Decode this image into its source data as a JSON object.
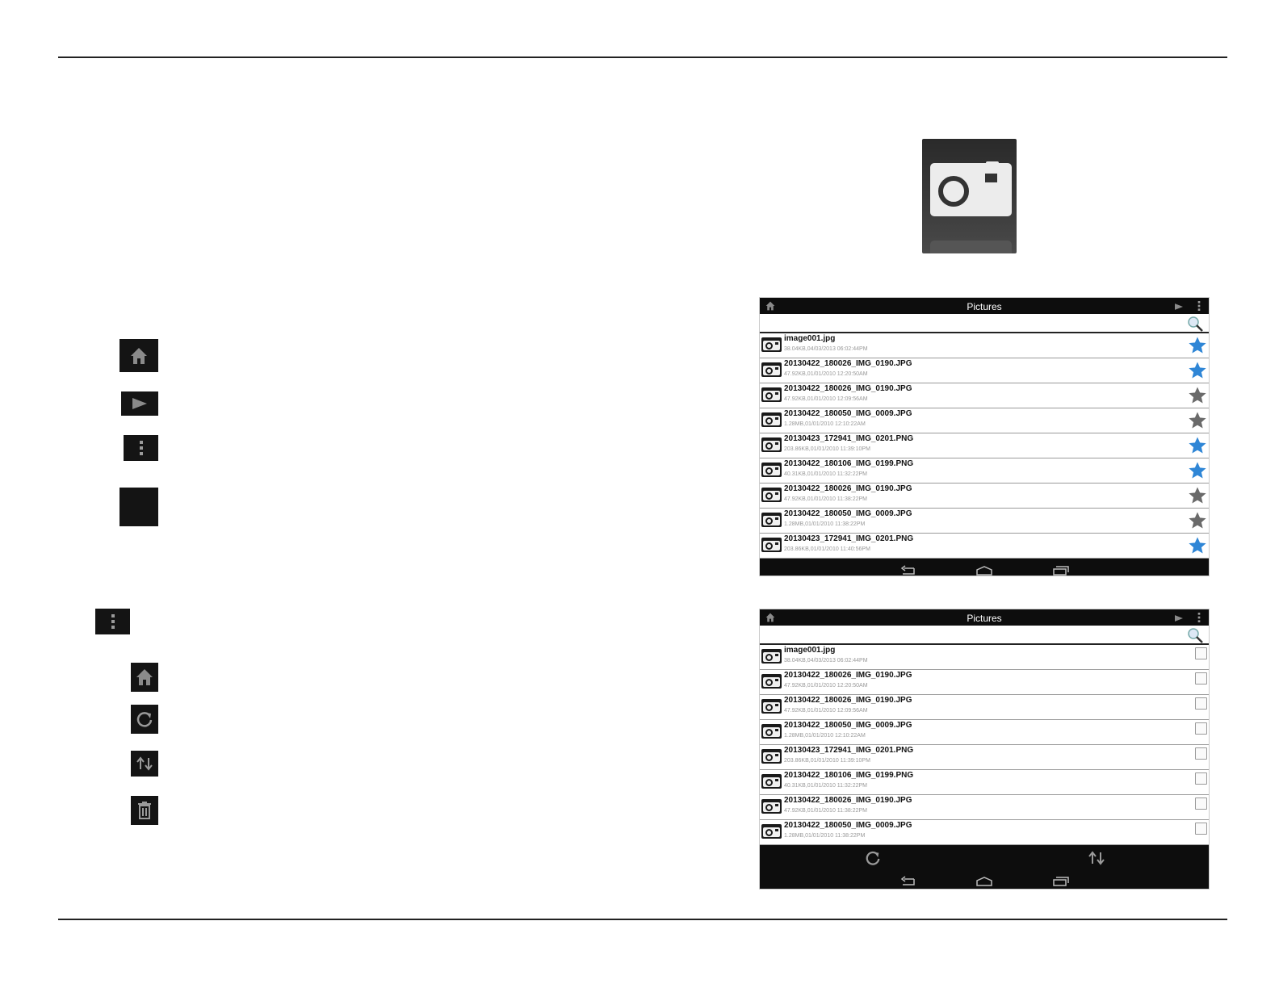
{
  "doc": {
    "icons_left": [
      {
        "name": "home-icon"
      },
      {
        "name": "play-icon"
      },
      {
        "name": "more-options-icon"
      },
      {
        "name": "blank-square-icon"
      }
    ],
    "menu_icon": "more-options-icon",
    "menu_icons": [
      {
        "name": "home-icon"
      },
      {
        "name": "refresh-icon"
      },
      {
        "name": "sort-icon"
      },
      {
        "name": "trash-icon"
      }
    ],
    "big_icon": "camera-icon"
  },
  "screens": [
    {
      "title": "Pictures",
      "rows": [
        {
          "name": "image001.jpg",
          "meta": "38.04KB,04/03/2013 06:02:44PM",
          "starred": true
        },
        {
          "name": "20130422_180026_IMG_0190.JPG",
          "meta": "47.92KB,01/01/2010 12:20:50AM",
          "starred": true
        },
        {
          "name": "20130422_180026_IMG_0190.JPG",
          "meta": "47.92KB,01/01/2010 12:09:56AM",
          "starred": false
        },
        {
          "name": "20130422_180050_IMG_0009.JPG",
          "meta": "1.28MB,01/01/2010 12:10:22AM",
          "starred": false
        },
        {
          "name": "20130423_172941_IMG_0201.PNG",
          "meta": "203.86KB,01/01/2010 11:39:10PM",
          "starred": true
        },
        {
          "name": "20130422_180106_IMG_0199.PNG",
          "meta": "40.31KB,01/01/2010 11:32:22PM",
          "starred": true
        },
        {
          "name": "20130422_180026_IMG_0190.JPG",
          "meta": "47.92KB,01/01/2010 11:38:22PM",
          "starred": false
        },
        {
          "name": "20130422_180050_IMG_0009.JPG",
          "meta": "1.28MB,01/01/2010 11:38:22PM",
          "starred": false
        },
        {
          "name": "20130423_172941_IMG_0201.PNG",
          "meta": "203.86KB,01/01/2010 11:40:56PM",
          "starred": true
        }
      ]
    },
    {
      "title": "Pictures",
      "rows": [
        {
          "name": "image001.jpg",
          "meta": "38.04KB,04/03/2013 06:02:44PM"
        },
        {
          "name": "20130422_180026_IMG_0190.JPG",
          "meta": "47.92KB,01/01/2010 12:20:50AM"
        },
        {
          "name": "20130422_180026_IMG_0190.JPG",
          "meta": "47.92KB,01/01/2010 12:09:56AM"
        },
        {
          "name": "20130422_180050_IMG_0009.JPG",
          "meta": "1.28MB,01/01/2010 12:10:22AM"
        },
        {
          "name": "20130423_172941_IMG_0201.PNG",
          "meta": "203.86KB,01/01/2010 11:39:10PM"
        },
        {
          "name": "20130422_180106_IMG_0199.PNG",
          "meta": "40.31KB,01/01/2010 11:32:22PM"
        },
        {
          "name": "20130422_180026_IMG_0190.JPG",
          "meta": "47.92KB,01/01/2010 11:38:22PM"
        },
        {
          "name": "20130422_180050_IMG_0009.JPG",
          "meta": "1.28MB,01/01/2010 11:38:22PM"
        }
      ]
    }
  ],
  "colors": {
    "star_on": "#2f86d6",
    "star_off": "#6a6a6a",
    "bar": "#0d0d0d"
  }
}
